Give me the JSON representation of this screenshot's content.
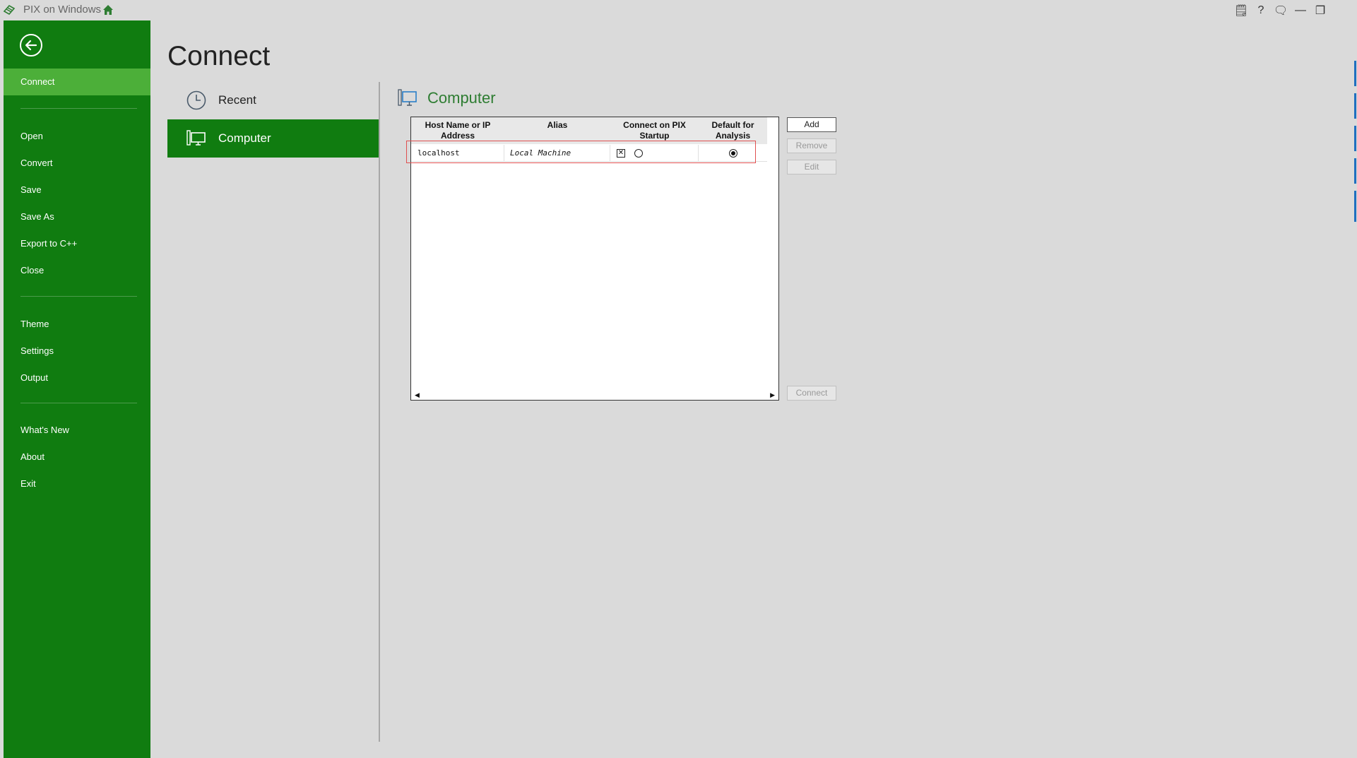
{
  "titlebar": {
    "app_title": "PIX on Windows",
    "icons": [
      "pix-logo-icon",
      "home-icon"
    ],
    "controls": [
      "feedback-icon",
      "help-icon",
      "comment-icon",
      "minimize-icon",
      "restore-icon"
    ],
    "controls_glyphs": {
      "feedback": "🗒",
      "help": "?",
      "comment": "🗨",
      "minimize": "—",
      "restore": "❐"
    }
  },
  "sidebar": {
    "back_icon": "back-arrow-icon",
    "items": [
      {
        "label": "Connect",
        "active": true
      },
      {
        "label": "Open"
      },
      {
        "label": "Convert"
      },
      {
        "label": "Save"
      },
      {
        "label": "Save As"
      },
      {
        "label": "Export to C++"
      },
      {
        "label": "Close"
      },
      {
        "label": "Theme"
      },
      {
        "label": "Settings"
      },
      {
        "label": "Output"
      },
      {
        "label": "What's New"
      },
      {
        "label": "About"
      },
      {
        "label": "Exit"
      }
    ]
  },
  "main": {
    "title": "Connect",
    "categories": [
      {
        "label": "Recent",
        "icon": "clock-icon"
      },
      {
        "label": "Computer",
        "icon": "computer-icon",
        "active": true
      }
    ],
    "section_title": "Computer",
    "grid": {
      "columns": [
        "Host Name or IP Address",
        "Alias",
        "Connect on PIX Startup",
        "Default for Analysis"
      ],
      "rows": [
        {
          "host": "localhost",
          "alias": "Local Machine",
          "checkbox_glyph": "✕",
          "connect_on_startup": true,
          "startup_radio": false,
          "default_for_analysis": true
        }
      ]
    },
    "buttons": {
      "add": "Add",
      "remove": "Remove",
      "edit": "Edit",
      "connect": "Connect"
    }
  },
  "colors": {
    "sidebar_green": "#107c10",
    "active_nav": "#4caf39",
    "section_title": "#2e7d32",
    "background": "#dadada"
  }
}
